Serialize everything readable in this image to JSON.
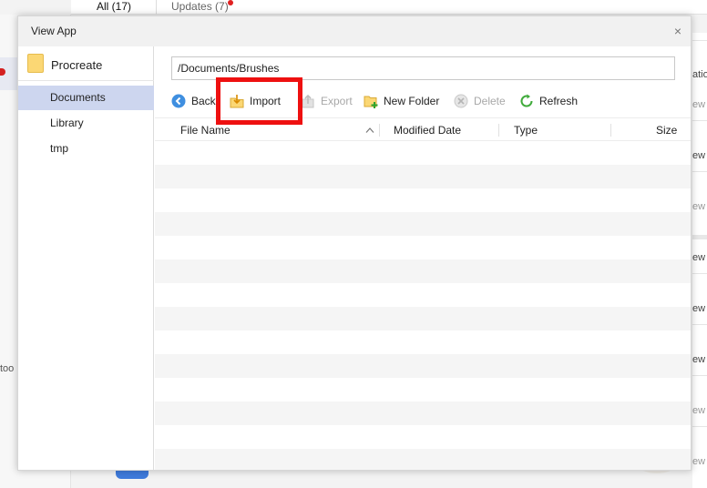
{
  "background": {
    "tabs": [
      {
        "label": "All (17)"
      },
      {
        "label": "Updates (7)"
      }
    ],
    "left_text": "too",
    "right_labels": [
      "atio",
      "ew",
      "ew",
      "ew",
      "ew",
      "ew",
      "ew",
      "ew",
      "ew"
    ]
  },
  "dialog": {
    "title": "View App",
    "close_glyph": "×"
  },
  "sidebar": {
    "app_name": "Procreate",
    "items": [
      {
        "label": "Documents",
        "active": true
      },
      {
        "label": "Library",
        "active": false
      },
      {
        "label": "tmp",
        "active": false
      }
    ]
  },
  "path": {
    "value": "/Documents/Brushes"
  },
  "toolbar": {
    "back_label": "Back",
    "import_label": "Import",
    "export_label": "Export",
    "new_folder_label": "New Folder",
    "delete_label": "Delete",
    "refresh_label": "Refresh"
  },
  "table": {
    "columns": [
      {
        "label": "File Name"
      },
      {
        "label": "Modified Date"
      },
      {
        "label": "Type"
      },
      {
        "label": "Size"
      }
    ],
    "rows": []
  },
  "colors": {
    "selection": "#cdd6ef",
    "highlight": "#ee1010",
    "folder": "#fbd774",
    "back_button": "#3f8fe0",
    "refresh": "#3faa3a"
  },
  "icons": [
    "folder-icon",
    "back-icon",
    "import-icon",
    "export-icon",
    "new-folder-icon",
    "delete-icon",
    "refresh-icon",
    "sort-up-icon",
    "close-icon"
  ]
}
